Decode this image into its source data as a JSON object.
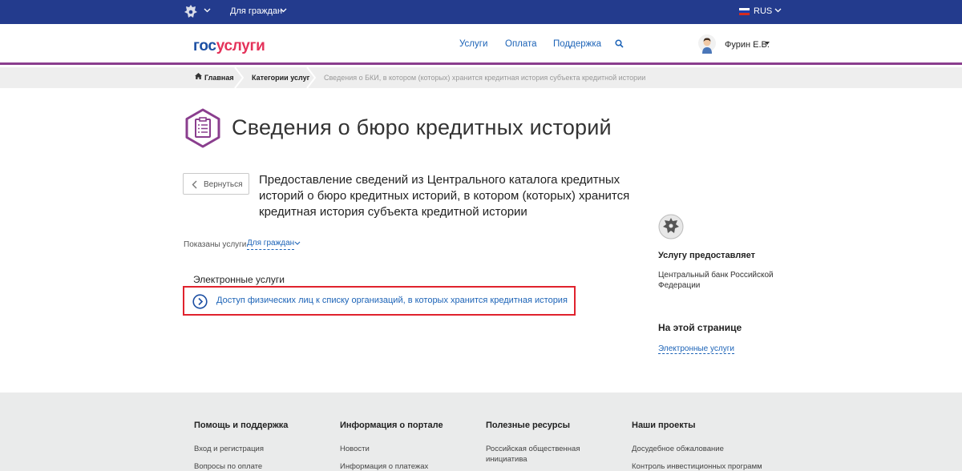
{
  "topbar": {
    "citizens_label": "Для граждан",
    "lang": "RUS",
    "bg_color": "#233b8d"
  },
  "header": {
    "logo_part1": "гос",
    "logo_part2": "услуги",
    "nav": [
      "Услуги",
      "Оплата",
      "Поддержка"
    ],
    "username": "Фурин Е.В.",
    "accent": "#8a3e8e"
  },
  "breadcrumb": {
    "home": "Главная",
    "category": "Категории услуг",
    "current": "Сведения о БКИ, в котором (которых) хранится кредитная история субъекта кредитной истории"
  },
  "page": {
    "title": "Сведения о бюро кредитных историй",
    "back_label": "Вернуться",
    "description": "Предоставление сведений из Центрального каталога кредитных историй о бюро кредитных историй, в котором (которых) хранится кредитная история субъекта кредитной истории",
    "shown_label": "Показаны услуги",
    "shown_filter": "Для граждан",
    "e_services_heading": "Электронные услуги",
    "service_link": "Доступ физических лиц к списку организаций, в которых хранится кредитная история"
  },
  "sidebar": {
    "provider_heading": "Услугу предоставляет",
    "provider_name": "Центральный банк Российской Федерации",
    "on_page_heading": "На этой странице",
    "on_page_link": "Электронные услуги"
  },
  "footer": {
    "columns": [
      {
        "heading": "Помощь и поддержка",
        "links": [
          "Вход и регистрация",
          "Вопросы по оплате"
        ]
      },
      {
        "heading": "Информация о портале",
        "links": [
          "Новости",
          "Информация о платежах"
        ]
      },
      {
        "heading": "Полезные ресурсы",
        "links": [
          "Российская общественная инициатива"
        ]
      },
      {
        "heading": "Наши проекты",
        "links": [
          "Досудебное обжалование",
          "Контроль инвестиционных программ"
        ]
      }
    ]
  }
}
